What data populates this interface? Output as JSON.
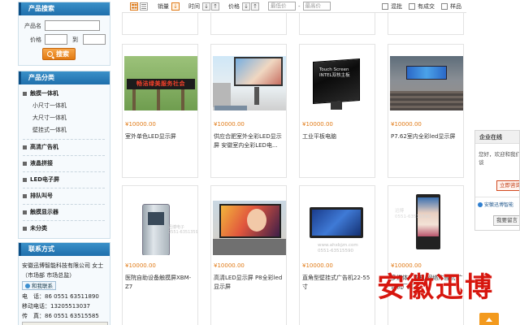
{
  "search": {
    "title": "产品搜索",
    "name_label": "产品名",
    "price_label": "价格",
    "to_label": "到",
    "button_label": "搜索"
  },
  "categories": {
    "title": "产品分类",
    "main1": "触摸一体机",
    "subs": [
      "小尺寸一体机",
      "大尺寸一体机",
      "壁挂式一体机"
    ],
    "main2": "高清广告机",
    "main3": "液晶拼接",
    "main4": "LED电子屏",
    "main5": "排队叫号",
    "main6": "触摸显示器",
    "main7": "未分类"
  },
  "contact": {
    "title": "联系方式",
    "company": "安徽迅博智能科技有限公司 女士（市场部 市场总监）",
    "qq_label": "和我联系",
    "phone": "电　话：86 0551 63511890",
    "mobile": "移动电话：13205513037",
    "fax": "传　真：86 0551 63515585",
    "map_control": "+"
  },
  "toolbar": {
    "sales_label": "销量",
    "time_label": "时间",
    "price_label": "价格",
    "price_min_placeholder": "最低价",
    "price_max_placeholder": "最高价",
    "dash": "-",
    "filter_hot": "混批",
    "filter_deals": "有成交",
    "filter_sample": "样品",
    "sort_down": "↓",
    "sort_up": "↑"
  },
  "products": [
    {
      "price": "¥10000.00",
      "name": "室外单色LED显示屏",
      "thumb_text": "畅洁绿美服务社会"
    },
    {
      "price": "¥10000.00",
      "name": "供应合肥室外全彩LED显示屏 安徽室内全彩LED电..."
    },
    {
      "price": "¥10000.00",
      "name": "工业平板电脑",
      "thumb_text": "Touch Screen\nINTEL双核主板"
    },
    {
      "price": "¥10000.00",
      "name": "P7.62室内全彩led显示屏"
    },
    {
      "price": "¥10000.00",
      "name": "医院自助设备触摸屏XBM-Z7",
      "thumb_text": "迅博电子\n0551-63513590"
    },
    {
      "price": "¥10000.00",
      "name": "高清LED显示屏 P8全彩led显示屏"
    },
    {
      "price": "¥10000.00",
      "name": "直角型壁挂式广告机22-55寸",
      "thumb_text": "www.ahxbjzn.com\n0551-63515590"
    },
    {
      "price": "¥10000.00",
      "name": "多媒体广告机 网络广告机 广告机厂家",
      "thumb_text": "迅博\n0551-63515590"
    }
  ],
  "brand_overlay": "安徽迅博",
  "chat": {
    "title": "企业在线",
    "message": "您好，欢迎和我们洽谈",
    "consult_button": "立即咨询",
    "company_link": "安徽迅博智能",
    "message_button": "我要留言"
  },
  "colors": {
    "brand_blue": "#2a7fc1",
    "accent_orange": "#e07a16",
    "brand_red": "#d7160e"
  }
}
